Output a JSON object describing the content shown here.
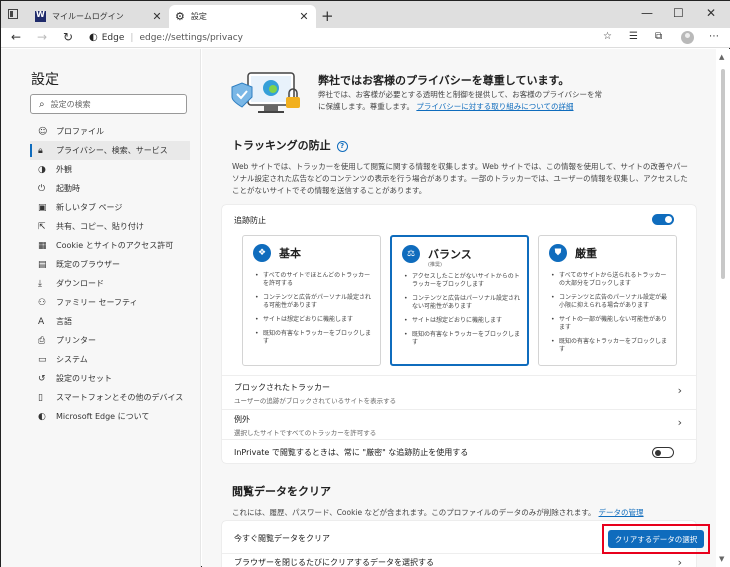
{
  "tabs": [
    {
      "label": "マイルームログイン",
      "close": "✕"
    },
    {
      "label": "設定",
      "close": "✕"
    }
  ],
  "new_tab": "+",
  "window_controls": {
    "minimize": "—",
    "maximize": "☐",
    "close": "✕"
  },
  "address": {
    "edge_label": "Edge",
    "separator": "|",
    "url": "edge://settings/privacy"
  },
  "sidebar": {
    "title": "設定",
    "search_placeholder": "設定の検索",
    "items": [
      {
        "label": "プロファイル",
        "icon": "profile-icon",
        "active": false
      },
      {
        "label": "プライバシー、検索、サービス",
        "icon": "lock-icon",
        "active": true
      },
      {
        "label": "外観",
        "icon": "appearance-icon",
        "active": false
      },
      {
        "label": "起動時",
        "icon": "power-icon",
        "active": false
      },
      {
        "label": "新しいタブ ページ",
        "icon": "newtab-icon",
        "active": false
      },
      {
        "label": "共有、コピー、貼り付け",
        "icon": "share-icon",
        "active": false
      },
      {
        "label": "Cookie とサイトのアクセス許可",
        "icon": "cookie-icon",
        "active": false
      },
      {
        "label": "既定のブラウザー",
        "icon": "browser-icon",
        "active": false
      },
      {
        "label": "ダウンロード",
        "icon": "download-icon",
        "active": false
      },
      {
        "label": "ファミリー セーフティ",
        "icon": "family-icon",
        "active": false
      },
      {
        "label": "言語",
        "icon": "language-icon",
        "active": false
      },
      {
        "label": "プリンター",
        "icon": "printer-icon",
        "active": false
      },
      {
        "label": "システム",
        "icon": "system-icon",
        "active": false
      },
      {
        "label": "設定のリセット",
        "icon": "reset-icon",
        "active": false
      },
      {
        "label": "スマートフォンとその他のデバイス",
        "icon": "phone-icon",
        "active": false
      },
      {
        "label": "Microsoft Edge について",
        "icon": "edge-icon",
        "active": false
      }
    ]
  },
  "privacy": {
    "title": "弊社ではお客様のプライバシーを尊重しています。",
    "desc": "弊社では、お客様が必要とする透明性と制御を提供して、お客様のプライバシーを常に保護します。尊重します。",
    "link": "プライバシーに対する取り組みについての詳細"
  },
  "tracking": {
    "title": "トラッキングの防止",
    "help": "?",
    "desc": "Web サイトでは、トラッカーを使用して閲覧に関する情報を収集します。Web サイトでは、この情報を使用して、サイトの改善やパーソナル設定された広告などのコンテンツの表示を行う場合があります。一部のトラッカーでは、ユーザーの情報を収集し、アクセスしたことがないサイトでその情報を送信することがあります。",
    "prevention_label": "追跡防止",
    "prevention_on": true,
    "options": [
      {
        "name": "基本",
        "subtitle": "",
        "selected": false,
        "icon": "basic-icon",
        "bullets": [
          "すべてのサイトでほとんどのトラッカーを許可する",
          "コンテンツと広告がパーソナル設定される可能性があります",
          "サイトは想定どおりに機能します",
          "既知の有害なトラッカーをブロックします"
        ]
      },
      {
        "name": "バランス",
        "subtitle": "(推奨)",
        "selected": true,
        "icon": "balance-icon",
        "bullets": [
          "アクセスしたことがないサイトからのトラッカーをブロックします",
          "コンテンツと広告はパーソナル設定されない可能性があります",
          "サイトは想定どおりに機能します",
          "既知の有害なトラッカーをブロックします"
        ]
      },
      {
        "name": "厳重",
        "subtitle": "",
        "selected": false,
        "icon": "strict-icon",
        "bullets": [
          "すべてのサイトから送られるトラッカーの大部分をブロックします",
          "コンテンツと広告のパーソナル設定が最小限に抑えられる場合があります",
          "サイトの一部が機能しない可能性があります",
          "既知の有害なトラッカーをブロックします"
        ]
      }
    ],
    "blocked_title": "ブロックされたトラッカー",
    "blocked_sub": "ユーザーの追跡がブロックされているサイトを表示する",
    "exceptions_title": "例外",
    "exceptions_sub": "選択したサイトですべてのトラッカーを許可する",
    "inprivate_label": "InPrivate で閲覧するときは、常に \"厳密\" な追跡防止を使用する",
    "inprivate_on": false
  },
  "clear": {
    "title": "閲覧データをクリア",
    "desc": "これには、履歴、パスワード、Cookie などが含まれます。このプロファイルのデータのみが削除されます。",
    "link": "データの管理",
    "now_label": "今すぐ閲覧データをクリア",
    "button": "クリアするデータの選択",
    "on_close_label": "ブラウザーを閉じるたびにクリアするデータを選択する"
  },
  "colors": {
    "accent": "#0f6cbd",
    "highlight": "#e8001c"
  }
}
